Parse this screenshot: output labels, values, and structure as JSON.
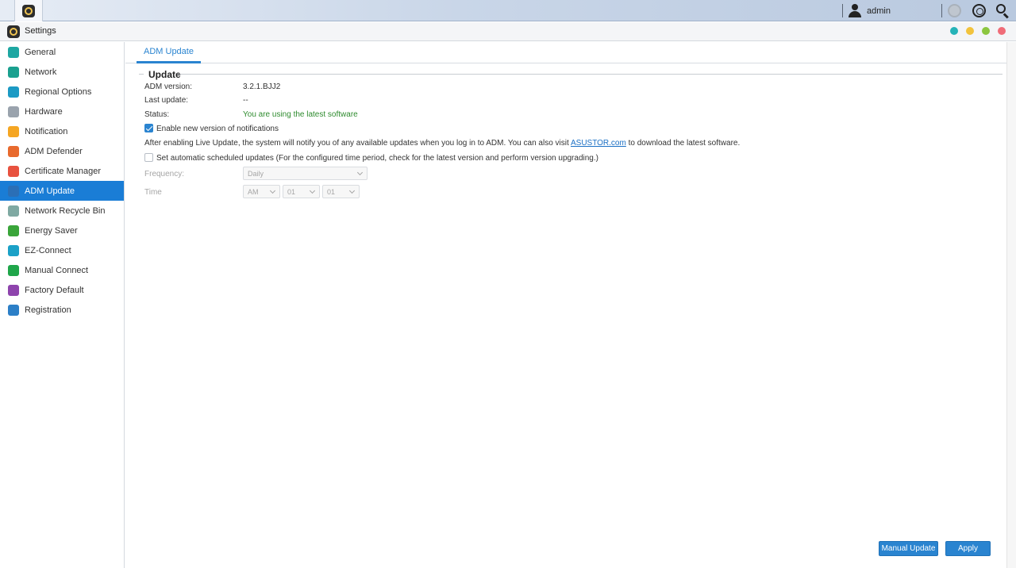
{
  "taskbar": {
    "app_icon": "settings-gear-icon",
    "user_icon": "user-icon",
    "username": "admin",
    "icons": [
      "notification-bell-icon",
      "globe-icon",
      "search-icon"
    ]
  },
  "window": {
    "title": "Settings",
    "title_icon": "settings-gear-icon",
    "buttons": [
      {
        "name": "help-button",
        "color": "#25b3b8"
      },
      {
        "name": "minimize-button",
        "color": "#f2c33c"
      },
      {
        "name": "maximize-button",
        "color": "#8cc63f"
      },
      {
        "name": "close-button",
        "color": "#f06c78"
      }
    ]
  },
  "sidebar": {
    "items": [
      {
        "label": "General",
        "icon": "general-icon",
        "color": "#1ea7a2"
      },
      {
        "label": "Network",
        "icon": "network-globe-icon",
        "color": "#1aa08f"
      },
      {
        "label": "Regional Options",
        "icon": "regional-options-icon",
        "color": "#1c9ac4"
      },
      {
        "label": "Hardware",
        "icon": "hardware-icon",
        "color": "#9aa3ad"
      },
      {
        "label": "Notification",
        "icon": "notification-icon",
        "color": "#f5a623"
      },
      {
        "label": "ADM Defender",
        "icon": "adm-defender-icon",
        "color": "#e86a2e"
      },
      {
        "label": "Certificate Manager",
        "icon": "certificate-icon",
        "color": "#e8523f"
      },
      {
        "label": "ADM Update",
        "icon": "adm-update-icon",
        "color": "#2b6fb6"
      },
      {
        "label": "Network Recycle Bin",
        "icon": "recycle-bin-icon",
        "color": "#7fa9a2"
      },
      {
        "label": "Energy Saver",
        "icon": "energy-saver-icon",
        "color": "#3aa53a"
      },
      {
        "label": "EZ-Connect",
        "icon": "ez-connect-cloud-icon",
        "color": "#1ba1c7"
      },
      {
        "label": "Manual Connect",
        "icon": "manual-connect-icon",
        "color": "#1fa64a"
      },
      {
        "label": "Factory Default",
        "icon": "factory-default-icon",
        "color": "#8e44ad"
      },
      {
        "label": "Registration",
        "icon": "registration-icon",
        "color": "#2c7fc7"
      }
    ],
    "active": "ADM Update"
  },
  "tabs": [
    {
      "label": "ADM Update"
    }
  ],
  "update": {
    "section_title": "Update",
    "adm_version_label": "ADM version:",
    "adm_version_value": "3.2.1.BJJ2",
    "last_update_label": "Last update:",
    "last_update_value": "--",
    "status_label": "Status:",
    "status_value": "You are using the latest software",
    "status_color": "#2e8b2e",
    "enable_notifications": {
      "label": "Enable new version of notifications",
      "checked": true
    },
    "info_text_before": "After enabling Live Update, the system will notify you of any available updates when you log in to ADM. You can also visit ",
    "info_link": "ASUSTOR.com",
    "info_text_after": " to download the latest software.",
    "auto_update": {
      "label": "Set automatic scheduled updates (For the configured time period, check for the latest version and perform version upgrading.)",
      "checked": false
    },
    "frequency_label": "Frequency:",
    "frequency_value": "Daily",
    "time_label": "Time",
    "time_ampm": "AM",
    "time_hour": "01",
    "time_minute": "01"
  },
  "buttons": {
    "manual_update": "Manual Update",
    "apply": "Apply",
    "color": "#2a84d0"
  }
}
